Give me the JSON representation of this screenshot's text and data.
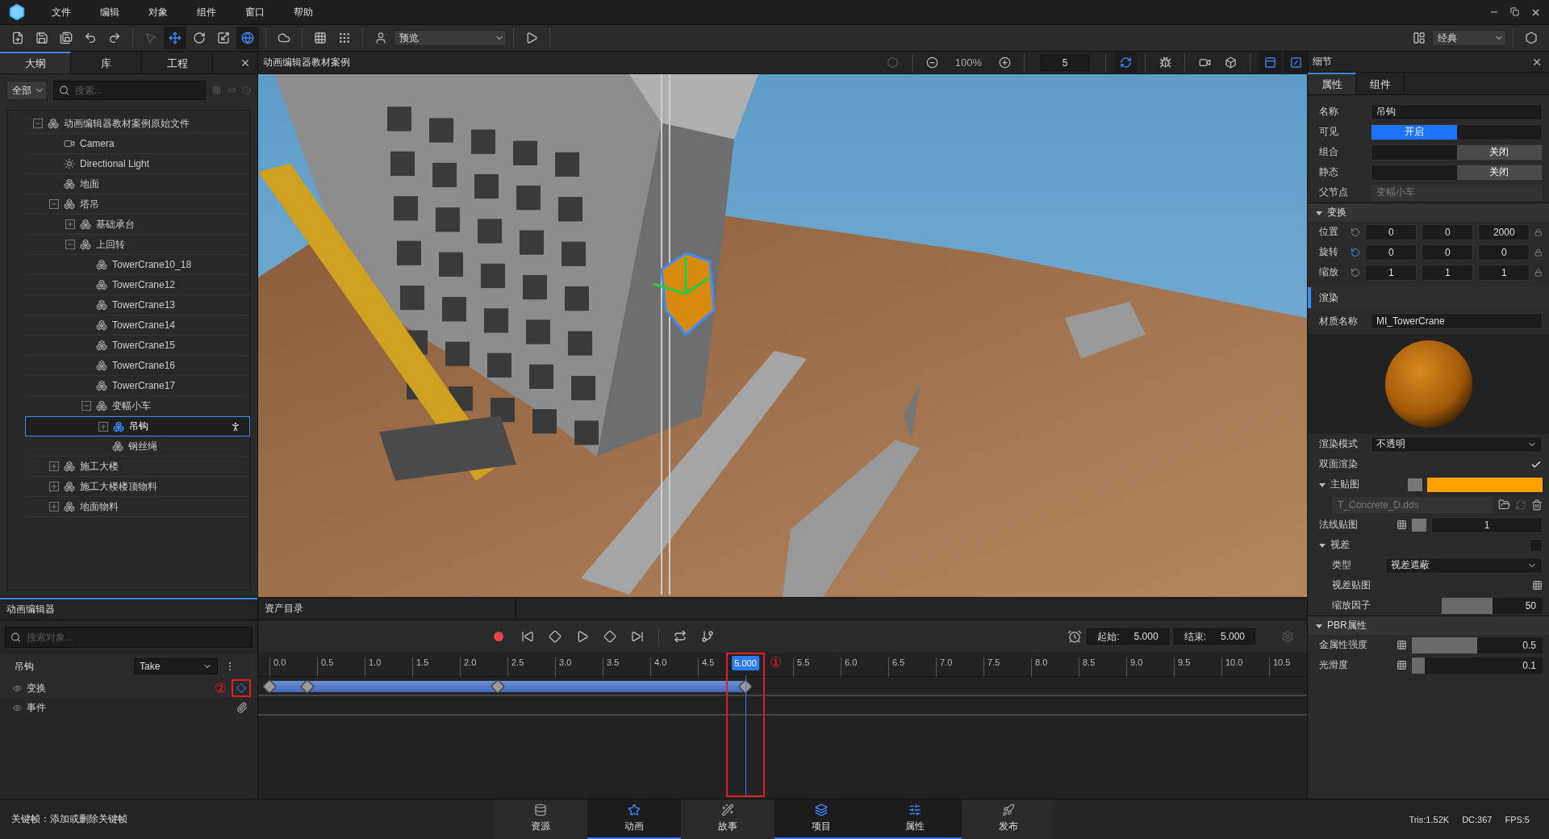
{
  "menu": [
    "文件",
    "编辑",
    "对象",
    "组件",
    "窗口",
    "帮助"
  ],
  "toolbar": {
    "tools": [
      {
        "kind": "select",
        "selected": false,
        "disabled": true
      },
      {
        "kind": "move",
        "selected": true,
        "disabled": false
      },
      {
        "kind": "rotate",
        "selected": false,
        "disabled": false
      },
      {
        "kind": "scale",
        "selected": false,
        "disabled": false
      },
      {
        "kind": "coord",
        "selected": true,
        "disabled": false
      }
    ],
    "preview_mode": "预览",
    "layout": "经典"
  },
  "outline": {
    "tabs": [
      {
        "label": "大纲",
        "selected": true
      },
      {
        "label": "库",
        "selected": false
      },
      {
        "label": "工程",
        "selected": false
      }
    ],
    "filter": "全部",
    "search_placeholder": "搜索...",
    "tree": [
      {
        "label": "动画编辑器教材案例原始文件",
        "kind": "object",
        "expanded": true,
        "selected": false,
        "children": [
          {
            "label": "Camera",
            "kind": "camera",
            "selected": false
          },
          {
            "label": "Directional Light",
            "kind": "light",
            "selected": false
          },
          {
            "label": "地面",
            "kind": "object",
            "selected": false
          },
          {
            "label": "塔吊",
            "kind": "object",
            "expanded": true,
            "selected": false,
            "children": [
              {
                "label": "基础承台",
                "kind": "object",
                "expanded": false,
                "selected": false
              },
              {
                "label": "上回转",
                "kind": "object",
                "expanded": true,
                "selected": false,
                "children": [
                  {
                    "label": "TowerCrane10_18",
                    "kind": "object",
                    "selected": false
                  },
                  {
                    "label": "TowerCrane12",
                    "kind": "object",
                    "selected": false
                  },
                  {
                    "label": "TowerCrane13",
                    "kind": "object",
                    "selected": false
                  },
                  {
                    "label": "TowerCrane14",
                    "kind": "object",
                    "selected": false
                  },
                  {
                    "label": "TowerCrane15",
                    "kind": "object",
                    "selected": false
                  },
                  {
                    "label": "TowerCrane16",
                    "kind": "object",
                    "selected": false
                  },
                  {
                    "label": "TowerCrane17",
                    "kind": "object",
                    "selected": false
                  },
                  {
                    "label": "变幅小车",
                    "kind": "object",
                    "expanded": true,
                    "selected": false,
                    "children": [
                      {
                        "label": "吊钩",
                        "kind": "object",
                        "expanded": false,
                        "selected": true,
                        "animated": true
                      },
                      {
                        "label": "钢丝绳",
                        "kind": "object",
                        "selected": false
                      }
                    ]
                  }
                ]
              }
            ]
          },
          {
            "label": "施工大楼",
            "kind": "object",
            "expanded": false,
            "selected": false
          },
          {
            "label": "施工大楼楼顶物料",
            "kind": "object",
            "expanded": false,
            "selected": false
          },
          {
            "label": "地面物料",
            "kind": "object",
            "expanded": false,
            "selected": false
          }
        ]
      }
    ]
  },
  "viewport": {
    "title": "动画编辑器教材案例",
    "zoom": "100%",
    "speed": "5"
  },
  "animation": {
    "title": "动画编辑器",
    "tab": "资产目录",
    "search_placeholder": "搜索对象...",
    "object": "吊钩",
    "take": "Take",
    "tracks": [
      {
        "label": "变换",
        "kind": "transform"
      },
      {
        "label": "事件",
        "kind": "event"
      }
    ],
    "ticks": [
      "0.0",
      "0.5",
      "1.0",
      "1.5",
      "2.0",
      "2.5",
      "3.0",
      "3.5",
      "4.0",
      "4.5",
      "5.5",
      "6.0",
      "6.5",
      "7.0",
      "7.5",
      "8.0",
      "8.5",
      "9.0",
      "9.5",
      "10.0",
      "10.5"
    ],
    "playhead": "5.000",
    "start_label": "起始:",
    "start": "5.000",
    "end_label": "结束:",
    "end": "5.000",
    "marks": [
      "①",
      "②"
    ]
  },
  "details": {
    "title": "细节",
    "tabs": [
      {
        "label": "属性",
        "selected": true
      },
      {
        "label": "组件",
        "selected": false
      }
    ],
    "fields": [
      {
        "kind": "text",
        "label": "名称",
        "value": "吊钩"
      },
      {
        "kind": "toggle",
        "label": "可见",
        "on": true,
        "text": "开启"
      },
      {
        "kind": "toggle",
        "label": "组合",
        "on": false,
        "text": "关闭"
      },
      {
        "kind": "toggle",
        "label": "静态",
        "on": false,
        "text": "关闭"
      },
      {
        "kind": "readonly",
        "label": "父节点",
        "value": "变幅小车"
      }
    ],
    "transform": {
      "title": "变换",
      "expanded": true,
      "rows": [
        {
          "label": "位置",
          "values": [
            "0",
            "0",
            "2000"
          ],
          "reset_active": false
        },
        {
          "label": "旋转",
          "values": [
            "0",
            "0",
            "0"
          ],
          "reset_active": true
        },
        {
          "label": "缩放",
          "values": [
            "1",
            "1",
            "1"
          ],
          "reset_active": false
        }
      ]
    },
    "render": {
      "title": "渲染",
      "material_label": "材质名称",
      "material": "MI_TowerCrane",
      "props": [
        {
          "kind": "select",
          "label": "渲染模式",
          "value": "不透明"
        },
        {
          "kind": "checkbox",
          "label": "双面渲染",
          "checked": true
        },
        {
          "kind": "color",
          "label": "主贴图",
          "expanded": true,
          "color": "#ffa000",
          "children": [
            {
              "kind": "file",
              "value": "T_Concrete_D.dds"
            }
          ]
        },
        {
          "kind": "map_value",
          "label": "法线贴图",
          "value": "1"
        },
        {
          "kind": "checkbox",
          "label": "视差",
          "checked": false,
          "expanded": true,
          "children": [
            {
              "kind": "select",
              "label": "类型",
              "value": "视差遮蔽"
            },
            {
              "kind": "map",
              "label": "视差贴图"
            },
            {
              "kind": "slider",
              "label": "缩放因子",
              "level": 0.5,
              "reading": "50"
            }
          ]
        }
      ]
    },
    "pbr": {
      "title": "PBR属性",
      "expanded": true,
      "props": [
        {
          "kind": "slider",
          "label": "金属性强度",
          "level": 0.5,
          "reading": "0.5",
          "map": true
        },
        {
          "kind": "slider",
          "label": "光滑度",
          "level": 0.1,
          "reading": "0.1",
          "map": true
        }
      ]
    }
  },
  "status": {
    "hint": "关键帧：添加或删除关键帧",
    "tabs": [
      {
        "label": "资源",
        "kind": "assets",
        "selected": false
      },
      {
        "label": "动画",
        "kind": "animation",
        "selected": true
      },
      {
        "label": "故事",
        "kind": "story",
        "selected": false
      },
      {
        "label": "项目",
        "kind": "project",
        "selected": true
      },
      {
        "label": "属性",
        "kind": "properties",
        "selected": true
      },
      {
        "label": "发布",
        "kind": "publish",
        "selected": false
      }
    ],
    "stats": [
      "Tris:1.52K",
      "DC:367",
      "FPS:5"
    ]
  }
}
